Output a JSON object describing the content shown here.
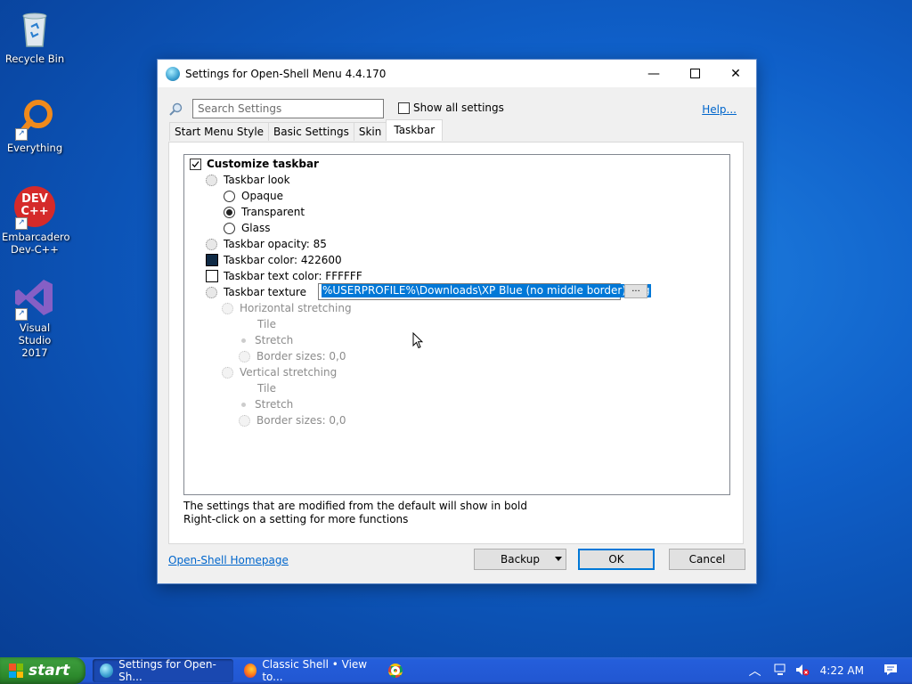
{
  "desktop": {
    "icons": [
      {
        "label": "Recycle Bin"
      },
      {
        "label": "Everything"
      },
      {
        "label": "Embarcadero Dev-C++",
        "line1": "Embarcadero",
        "line2": "Dev-C++",
        "badge": "DEV C++"
      },
      {
        "label": "Visual Studio 2017",
        "line1": "Visual Studio",
        "line2": "2017"
      }
    ]
  },
  "window": {
    "title": "Settings for Open-Shell Menu 4.4.170",
    "controls": {
      "minimize": "—",
      "close": "✕"
    },
    "search_placeholder": "Search Settings",
    "show_all_label": "Show all settings",
    "help_label": "Help...",
    "tabs": [
      {
        "label": "Start Menu Style",
        "active": false
      },
      {
        "label": "Basic Settings",
        "active": false
      },
      {
        "label": "Skin",
        "active": false
      },
      {
        "label": "Taskbar",
        "active": true
      }
    ],
    "tree": {
      "customize_taskbar": "Customize taskbar",
      "taskbar_look": "Taskbar look",
      "opaque": "Opaque",
      "transparent": "Transparent",
      "glass": "Glass",
      "opacity": "Taskbar opacity: 85",
      "color": "Taskbar color: 422600",
      "text_color": "Taskbar text color: FFFFFF",
      "texture_label": "Taskbar texture",
      "texture_value": "%USERPROFILE%\\Downloads\\XP Blue (no middle border).png",
      "browse": "...",
      "horizontal_stretching": "Horizontal stretching",
      "h_tile": "Tile",
      "h_stretch": "Stretch",
      "h_border": "Border sizes: 0,0",
      "vertical_stretching": "Vertical stretching",
      "v_tile": "Tile",
      "v_stretch": "Stretch",
      "v_border": "Border sizes: 0,0"
    },
    "note_line1": "The settings that are modified from the default will show in bold",
    "note_line2": "Right-click on a setting for more functions",
    "homepage_label": "Open-Shell Homepage",
    "buttons": {
      "backup": "Backup",
      "ok": "OK",
      "cancel": "Cancel"
    }
  },
  "colors": {
    "taskbar_color_swatch": "#0f2a45",
    "text_color_swatch": "#ffffff",
    "selection": "#0078d7"
  },
  "taskbar": {
    "start_label": "start",
    "tasks": [
      {
        "label": "Settings for Open-Sh...",
        "icon": "open-shell-icon"
      },
      {
        "label": "Classic Shell • View to...",
        "icon": "firefox-icon"
      },
      {
        "label": "",
        "icon": "chrome-icon"
      }
    ],
    "time": "4:22 AM"
  }
}
